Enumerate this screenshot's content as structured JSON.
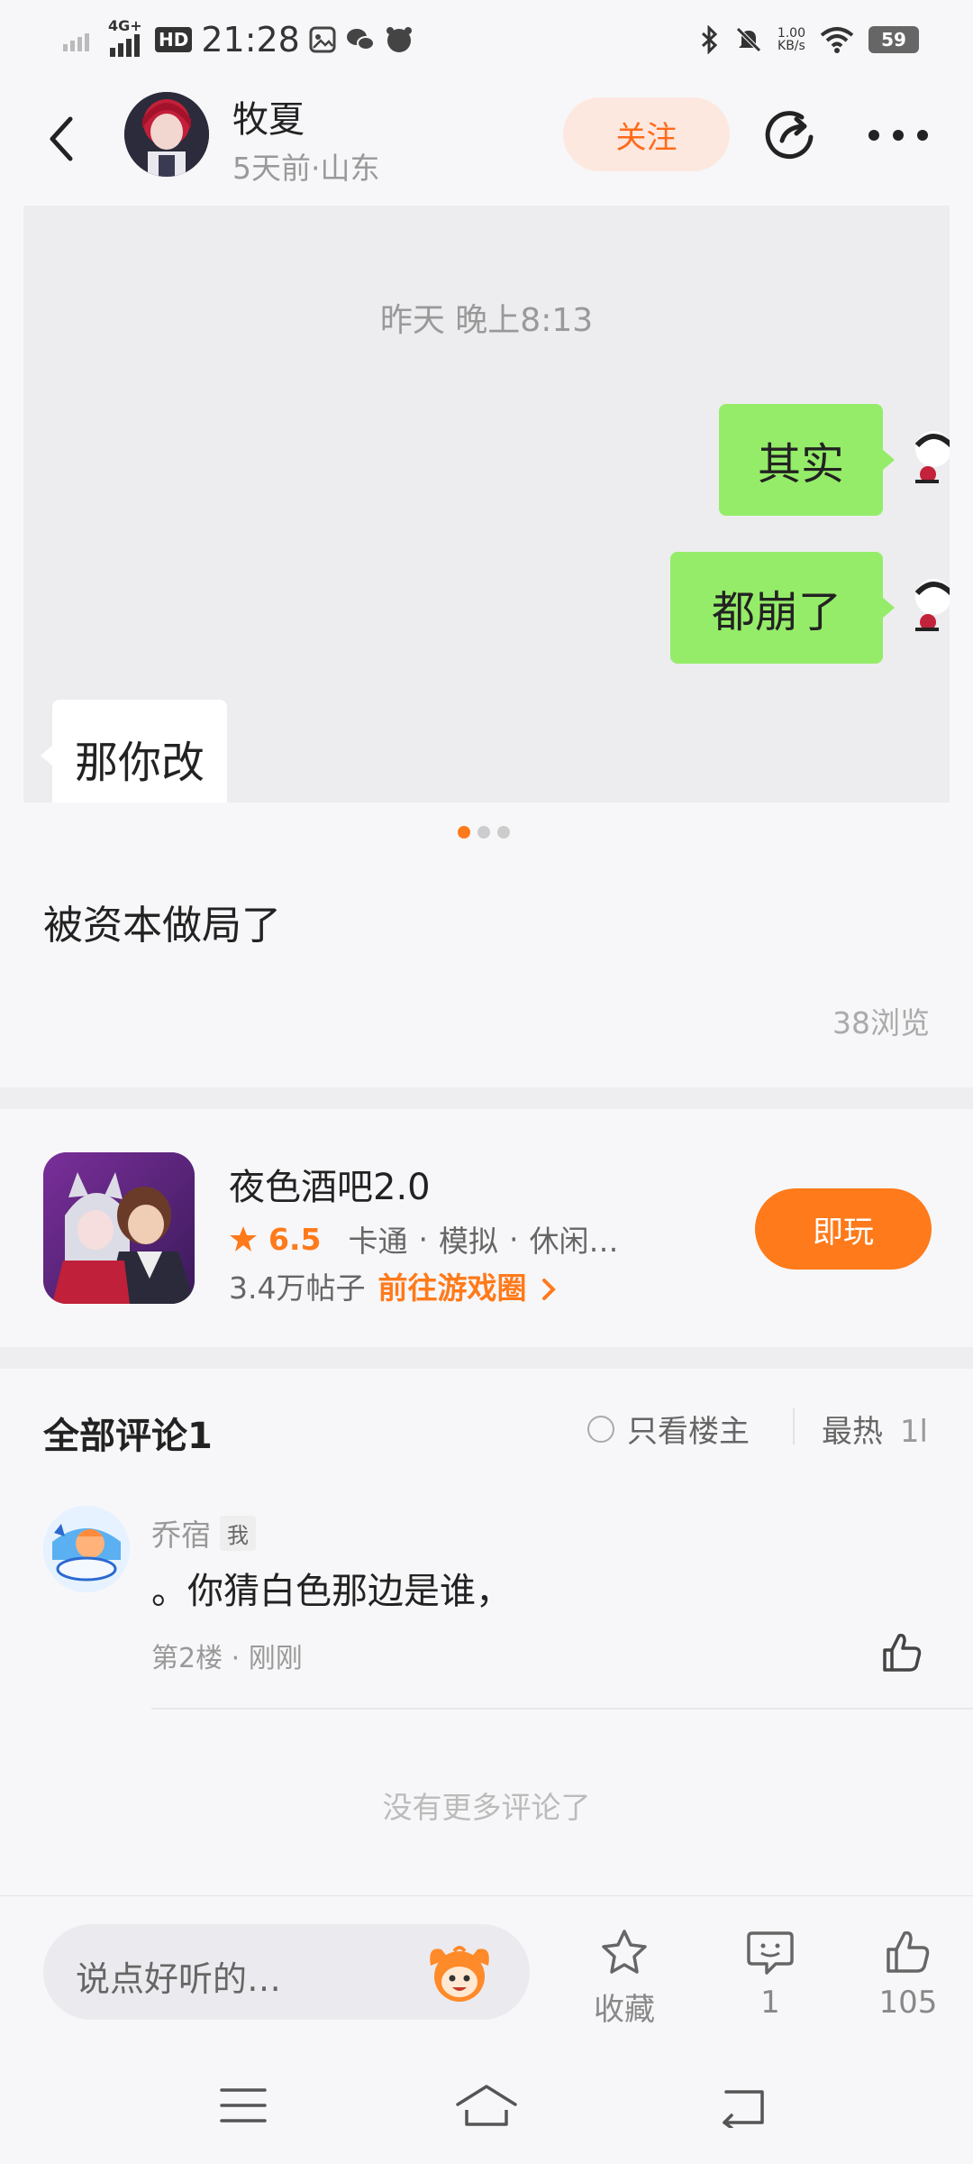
{
  "status_bar": {
    "network": "4G+",
    "hd": "HD",
    "time": "21:28",
    "speed_value": "1.00",
    "speed_unit": "KB/s",
    "battery": "59"
  },
  "header": {
    "author_name": "牧夏",
    "author_meta": "5天前·山东",
    "follow_label": "关注"
  },
  "post": {
    "image": {
      "time": "昨天 晚上8:13",
      "bubble_1": "其实",
      "bubble_2": "都崩了",
      "bubble_3": "那你改"
    },
    "carousel": {
      "count": 3,
      "active_index": 0
    },
    "text": "被资本做局了",
    "views": "38浏览"
  },
  "game": {
    "title": "夜色酒吧2.0",
    "rating": "6.5",
    "tags": [
      "卡通",
      "模拟",
      "休闲…"
    ],
    "separator": "·",
    "posts": "3.4万帖子",
    "goto": "前往游戏圈",
    "play_label": "即玩"
  },
  "comments": {
    "title": "全部评论1",
    "only_host": "只看楼主",
    "sort": "最热",
    "sort_suffix": "1l",
    "items": [
      {
        "name": "乔宿",
        "badge": "我",
        "text": "。你猜白色那边是谁，",
        "meta": "第2楼 · 刚刚"
      }
    ],
    "no_more": "没有更多评论了"
  },
  "bottom_bar": {
    "input_placeholder": "说点好听的…",
    "favorite_label": "收藏",
    "comment_count": "1",
    "like_count": "105"
  },
  "icons": {
    "back": "back-arrow-icon",
    "share": "share-icon",
    "more": "more-dots-icon",
    "star": "star-icon",
    "like": "thumbs-up-icon",
    "comment": "comment-icon",
    "menu": "menu-icon",
    "home": "home-icon",
    "return": "return-icon"
  },
  "colors": {
    "accent": "#ff7a1a",
    "follow_bg": "#fde8df",
    "chat_green": "#95ec69"
  }
}
